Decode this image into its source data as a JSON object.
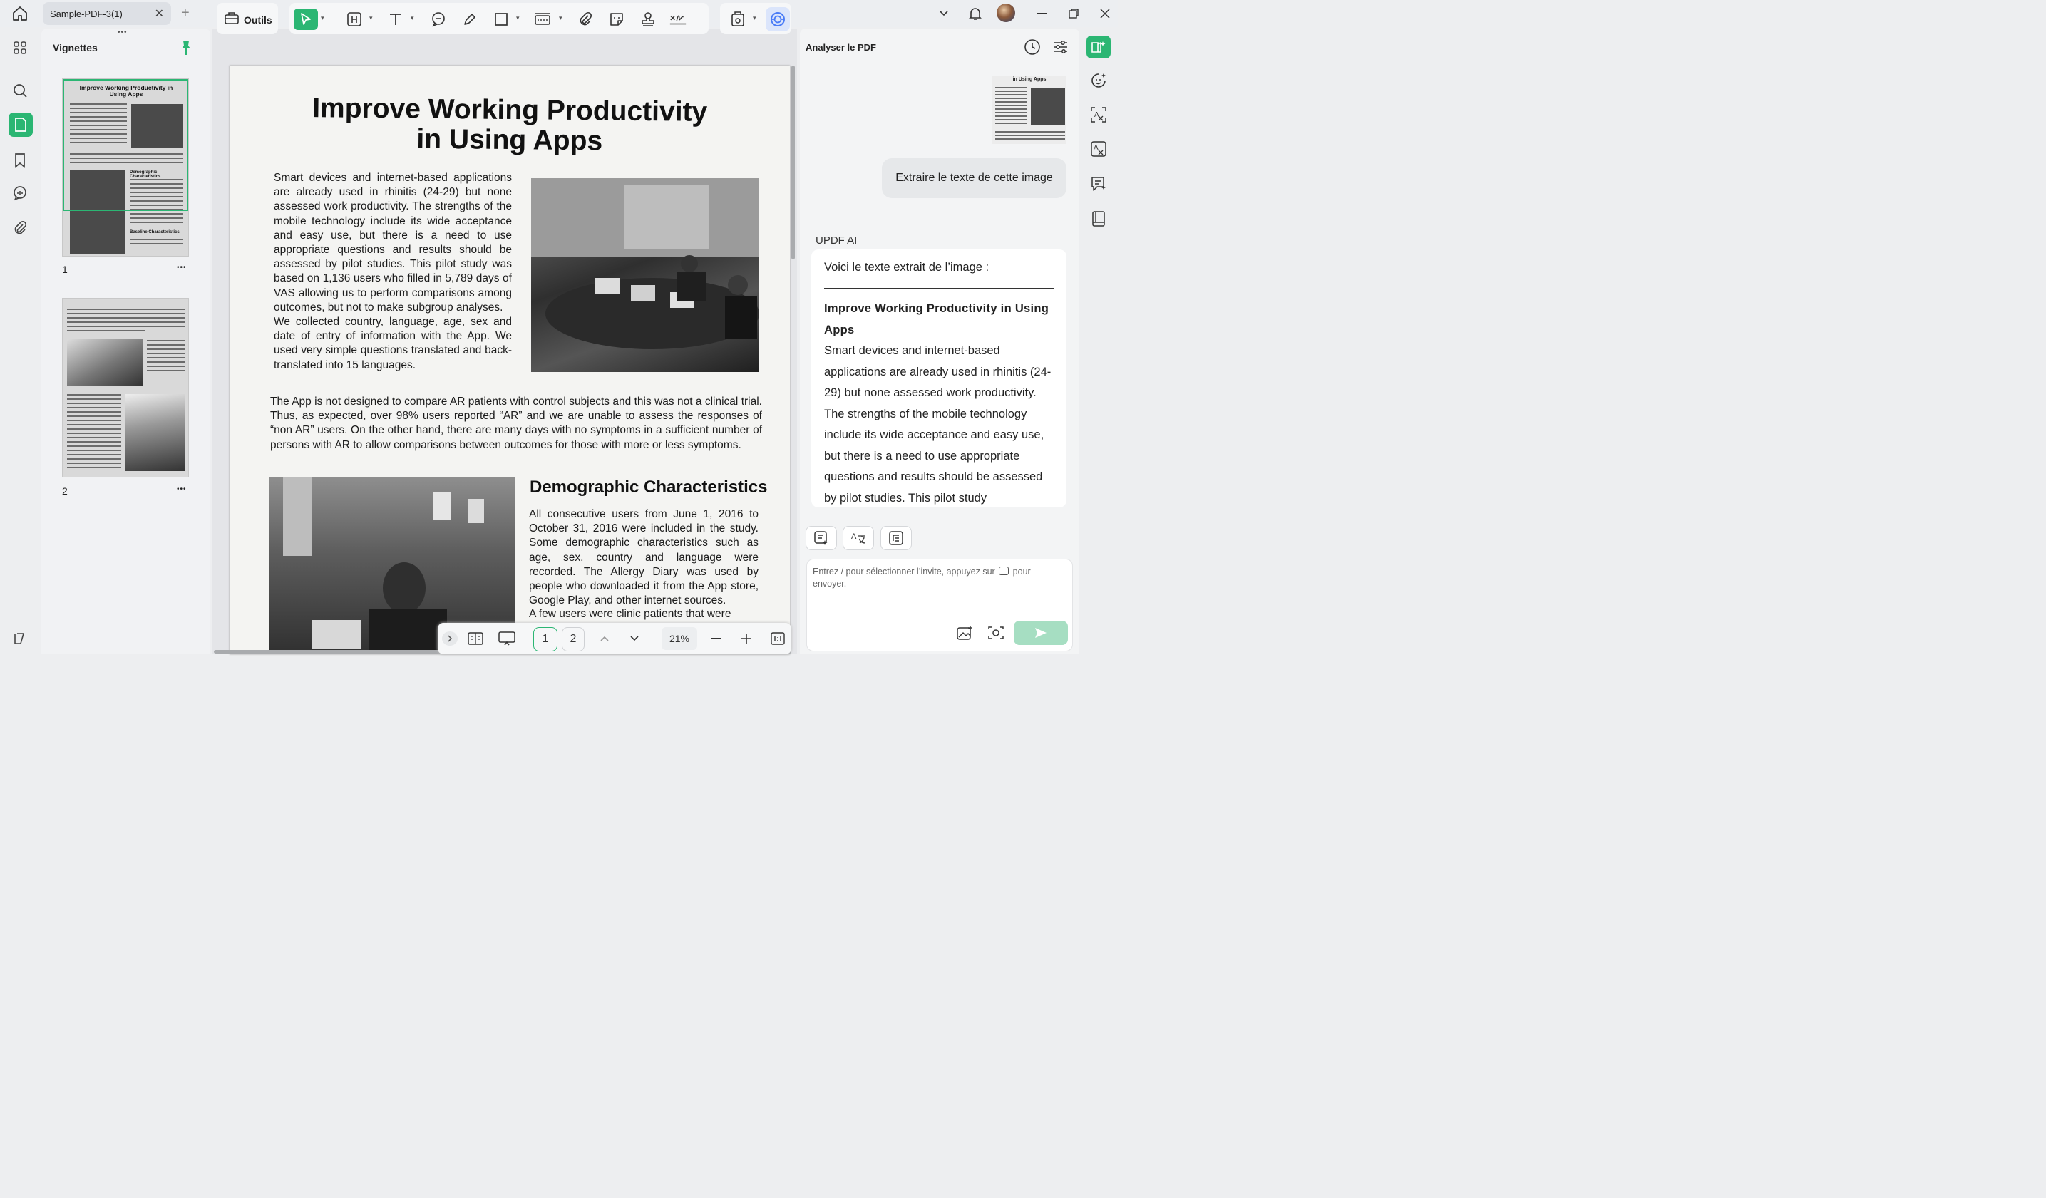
{
  "titlebar": {
    "tab_title": "Sample-PDF-3(1)",
    "tab_close": "✕",
    "new_tab": "+"
  },
  "thumbnails": {
    "title": "Vignettes",
    "more": "•••",
    "pages": [
      {
        "label": "1",
        "menu": "•••",
        "title": "Improve Working Productivity in Using Apps",
        "heading2": "Demographic Characteristics",
        "heading3": "Baseline Characteristics"
      },
      {
        "label": "2",
        "menu": "•••"
      }
    ]
  },
  "toolbar": {
    "tools_label": "Outils"
  },
  "document": {
    "title_line1": "Improve Working Productivity",
    "title_line2": "in Using Apps",
    "para1": "Smart devices and internet-based applications are already used in rhinitis (24-29) but none assessed work productivity. The strengths of the mobile technology include its wide acceptance and easy use, but there is a need to use appropriate questions and results should be assessed by pilot studies. This pilot study was based on 1,136 users who filled in 5,789 days of VAS allowing us to perform comparisons among outcomes, but not to make subgroup analyses.",
    "para2": "We collected country, language, age, sex and date of entry of information with the App. We used very simple questions translated and back-translated into 15 languages.",
    "para3": "The App is not designed to compare AR patients with control subjects and this was not a clinical trial. Thus, as expected, over 98% users reported “AR” and we are unable to assess the responses of “non AR” users. On the other hand, there are many days with no symptoms in a sufficient number of persons with AR to allow comparisons between outcomes for those with more or less symptoms.",
    "heading2": "Demographic Characteristics",
    "para4": "All consecutive users from June 1, 2016 to October 31, 2016 were included in the study. Some demographic characteristics such as age, sex, country and language were recorded. The Allergy Diary was used by people who downloaded it from the App store, Google Play, and other internet sources.",
    "para5": "A few users were clinic patients that were"
  },
  "bottombar": {
    "page1": "1",
    "page2": "2",
    "zoom": "21%"
  },
  "aipanel": {
    "title": "Analyser le PDF",
    "user_message": "Extraire le texte de cette image",
    "ai_name": "UPDF AI",
    "ai_intro": "Voici le texte extrait de l’image :",
    "ai_heading": "Improve Working Productivity in Using Apps",
    "ai_body": "Smart devices and internet-based applications are already used in rhinitis (24-29) but none assessed work productivity. The strengths of the mobile technology include its wide acceptance and easy use, but there is a need to use appropriate questions and results should be assessed by pilot studies. This pilot study",
    "input_placeholder_a": "Entrez / pour sélectionner l’invite, appuyez sur",
    "input_placeholder_b": "pour envoyer.",
    "thumb_caption": "in Using Apps"
  },
  "colors": {
    "accent": "#2bb673",
    "ai_accent": "#4a7cf7"
  }
}
